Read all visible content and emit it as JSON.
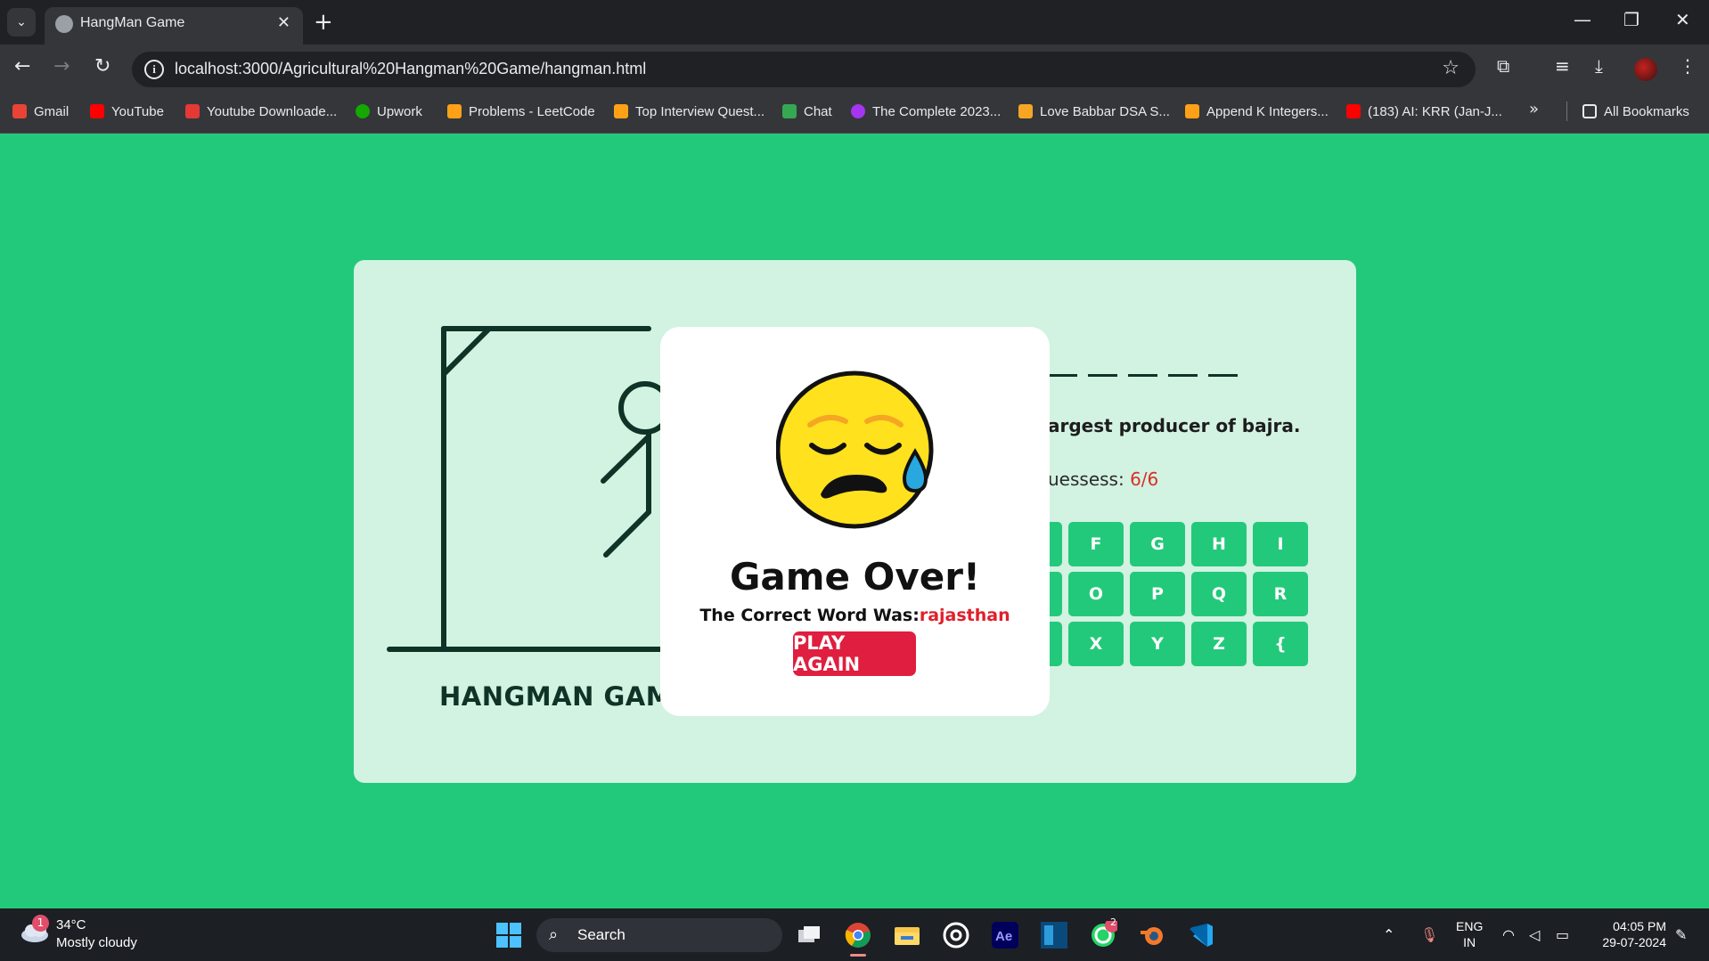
{
  "browser": {
    "tab_title": "HangMan Game",
    "url": "localhost:3000/Agricultural%20Hangman%20Game/hangman.html",
    "bookmarks": [
      {
        "label": "Gmail",
        "color": "#ea4335"
      },
      {
        "label": "YouTube",
        "color": "#ff0000"
      },
      {
        "label": "Youtube Downloade...",
        "color": "#e53935"
      },
      {
        "label": "Upwork",
        "color": "#14a800"
      },
      {
        "label": "Problems - LeetCode",
        "color": "#ffa116"
      },
      {
        "label": "Top Interview Quest...",
        "color": "#ffa116"
      },
      {
        "label": "Chat",
        "color": "#34a853"
      },
      {
        "label": "The Complete 2023...",
        "color": "#a435f0"
      },
      {
        "label": "Love Babbar DSA S...",
        "color": "#f5a623"
      },
      {
        "label": "Append K Integers...",
        "color": "#ffa116"
      },
      {
        "label": "(183) AI: KRR (Jan-J...",
        "color": "#ff0000"
      }
    ],
    "all_bookmarks": "All Bookmarks"
  },
  "game": {
    "title": "HANGMAN GAME",
    "word_blanks": 5,
    "hint": "Rajasthan is the largest producer of bajra.",
    "hint_visible": "argest producer of bajra.",
    "guesses_label": "uessess: ",
    "guesses_count": "6/6",
    "keys_visible": [
      "E",
      "F",
      "G",
      "H",
      "I",
      "N",
      "O",
      "P",
      "Q",
      "R",
      "W",
      "X",
      "Y",
      "Z",
      "{"
    ],
    "key_color": "#23c97a",
    "background_color": "#23c97a"
  },
  "modal": {
    "title": "Game Over!",
    "subtitle_prefix": "The Correct Word Was:",
    "correct_word": "rajasthan",
    "button_label": "PLAY AGAIN",
    "emoji": "sad-sweat-face-icon",
    "button_color": "#e01e3f"
  },
  "taskbar": {
    "weather_badge": "1",
    "temperature": "34°C",
    "weather": "Mostly cloudy",
    "search_placeholder": "Search",
    "whatsapp_badge": "2",
    "lang_top": "ENG",
    "lang_bottom": "IN",
    "time": "04:05 PM",
    "date": "29-07-2024"
  }
}
